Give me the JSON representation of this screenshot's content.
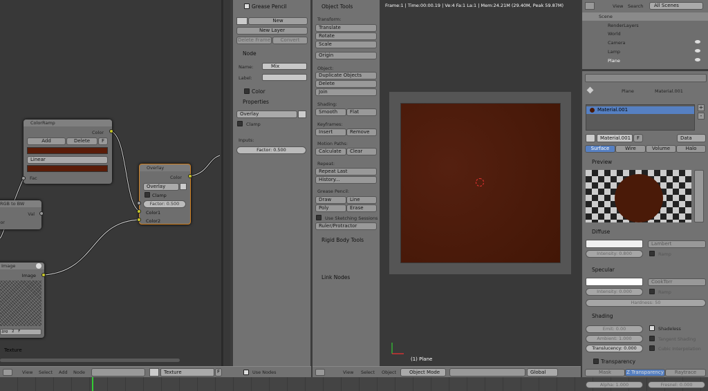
{
  "node_editor": {
    "colorramp": {
      "title": "ColorRamp",
      "out_color": "Color",
      "add": "Add",
      "delete": "Delete",
      "f": "F",
      "interp": "Linear",
      "in_fac": "Fac"
    },
    "rgbtobw": {
      "title": "RGB to BW",
      "out_val": "Val",
      "in_color": "Color"
    },
    "overlay": {
      "title": "Overlay",
      "out_color": "Color",
      "blend": "Overlay",
      "clamp": "Clamp",
      "factor": "Factor: 0.500",
      "color1": "Color1",
      "color2": "Color2"
    },
    "image": {
      "title": "Image",
      "out_image": "Image",
      "file": ".jpg",
      "users": "2",
      "f": "F"
    },
    "label_texture": "Texture",
    "header": {
      "view": "View",
      "select": "Select",
      "add": "Add",
      "node": "Node",
      "texture_field": "Texture",
      "f": "F",
      "use_nodes": "Use Nodes"
    }
  },
  "npanel": {
    "grease_pencil": {
      "title": "Grease Pencil",
      "new": "New",
      "new_layer": "New Layer",
      "delete_frame": "Delete Frame",
      "convert": "Convert"
    },
    "node": {
      "title": "Node",
      "name_label": "Name:",
      "name_value": "Mix",
      "label_label": "Label:",
      "label_value": ""
    },
    "color_title": "Color",
    "properties": {
      "title": "Properties",
      "blend": "Overlay",
      "clamp": "Clamp",
      "inputs": "Inputs:",
      "factor": "Factor: 0.500"
    }
  },
  "toolshelf": {
    "title": "Object Tools",
    "transform": "Transform:",
    "translate": "Translate",
    "rotate": "Rotate",
    "scale": "Scale",
    "origin": "Origin",
    "object": "Object:",
    "duplicate": "Duplicate Objects",
    "delete": "Delete",
    "join": "Join",
    "shading": "Shading:",
    "smooth": "Smooth",
    "flat": "Flat",
    "keyframes": "Keyframes:",
    "insert": "Insert",
    "remove": "Remove",
    "motion_paths": "Motion Paths:",
    "calculate": "Calculate",
    "clear": "Clear",
    "repeat": "Repeat:",
    "repeat_last": "Repeat Last",
    "history": "History...",
    "grease_pencil": "Grease Pencil:",
    "draw": "Draw",
    "line": "Line",
    "poly": "Poly",
    "erase": "Erase",
    "use_sketching": "Use Sketching Sessions",
    "ruler": "Ruler/Protractor",
    "rigid_body": "Rigid Body Tools",
    "link_nodes": "Link Nodes"
  },
  "viewport": {
    "info": "Frame:1 | Time:00:00.19 | Ve:4 Fa:1 La:1 | Mem:24.21M (29.40M, Peak 59.87M)",
    "object_label": "(1) Plane",
    "header": {
      "view": "View",
      "select": "Select",
      "object": "Object",
      "mode": "Object Mode",
      "orientation": "Global"
    }
  },
  "outliner": {
    "view": "View",
    "search": "Search",
    "scenes": "All Scenes",
    "items": [
      "Scene",
      "RenderLayers",
      "World",
      "Camera",
      "Lamp",
      "Plane"
    ]
  },
  "properties": {
    "breadcrumb_obj": "Plane",
    "breadcrumb_mat": "Material.001",
    "slot": "Material.001",
    "mat_name": "Material.001",
    "mat_f": "F",
    "data": "Data",
    "tabs": [
      "Surface",
      "Wire",
      "Volume",
      "Halo"
    ],
    "preview": "Preview",
    "diffuse": {
      "title": "Diffuse",
      "shader": "Lambert",
      "intensity": "Intensity: 0.800",
      "ramp": "Ramp"
    },
    "specular": {
      "title": "Specular",
      "shader": "CookTorr",
      "intensity": "Intensity: 0.000",
      "ramp": "Ramp",
      "hardness": "Hardness: 50"
    },
    "shading": {
      "title": "Shading",
      "emit": "Emit: 0.00",
      "ambient": "Ambient: 1.000",
      "translucency": "Translucency: 0.000",
      "shadeless": "Shadeless",
      "tangent": "Tangent Shading",
      "cubic": "Cubic Interpolation"
    },
    "transparency": {
      "title": "Transparency",
      "mask": "Mask",
      "ztrans": "Z Transparency",
      "raytrace": "Raytrace",
      "alpha": "Alpha: 1.000",
      "fresnel": "Fresnel: 0.000"
    }
  },
  "colors": {
    "material": "#4a1a08",
    "accent": "#5680c2"
  }
}
